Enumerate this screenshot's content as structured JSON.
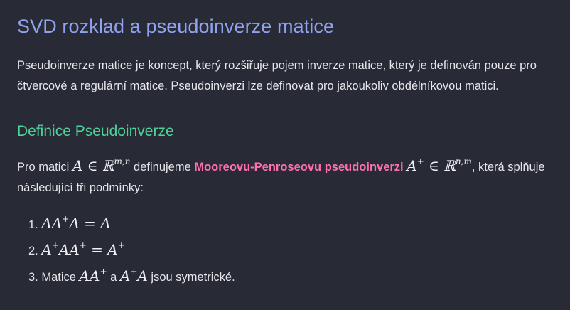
{
  "title": "SVD rozklad a pseudoinverze matice",
  "intro": "Pseudoinverze matice je koncept, který rozšiřuje pojem inverze matice, který je definován pouze pro čtvercové a regulární matice. Pseudoinverzi lze definovat pro jakoukoliv obdélníkovou matici.",
  "section": {
    "heading": "Definice Pseudoinverze",
    "def_prefix": "Pro matici ",
    "def_math1": "A ∈ ℝ",
    "def_math1_sup": "m,n",
    "def_mid": " definujeme ",
    "def_highlight": "Mooreovu-Penroseovu pseudoinverzi",
    "def_math2": "A",
    "def_math2_sup": "+",
    "def_math3": " ∈ ℝ",
    "def_math3_sup": "n,m",
    "def_suffix": ", která splňuje následující tři podmínky:"
  },
  "conditions": [
    {
      "num": "1.",
      "a": "AA",
      "a_sup": "+",
      "b": "A = A"
    },
    {
      "num": "2.",
      "a": "A",
      "a_sup": "+",
      "b": "AA",
      "b_sup": "+",
      "c": " = A",
      "c_sup": "+"
    },
    {
      "num": "3.",
      "pre": "Matice ",
      "a": "AA",
      "a_sup": "+",
      "mid": " a ",
      "b": "A",
      "b_sup": "+",
      "c": "A",
      "post": " jsou symetrické."
    }
  ],
  "colors": {
    "background": "#282a36",
    "title": "#8fa3f0",
    "subheading": "#4fd19a",
    "highlight": "#ff6fb0",
    "text": "#e6e6ea"
  }
}
